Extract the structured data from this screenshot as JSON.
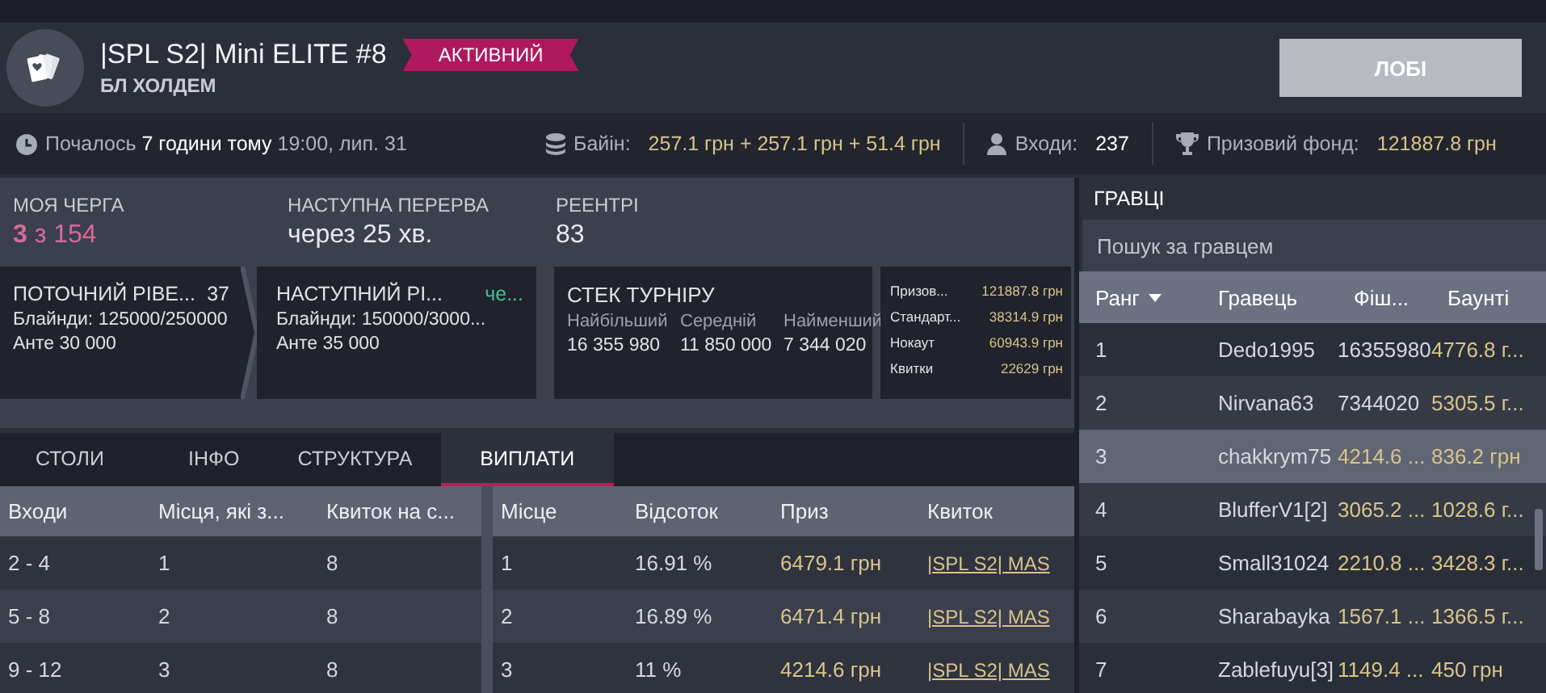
{
  "header": {
    "title": "|SPL S2| Mini ELITE #8",
    "status": "АКТИВНИЙ",
    "game": "БЛ ХОЛДЕМ",
    "lobby_button": "ЛОБІ"
  },
  "info_bar": {
    "started": "Почалось **7 години тому** 19:00, лип. 31",
    "buyin_label": "Байін:",
    "buyin": "257.1 грн + 257.1 грн + 51.4 грн",
    "entries_label": "Входи:",
    "entries": "237",
    "prize_label": "Призовий фонд:",
    "prize": "121887.8 грн"
  },
  "stats": [
    {
      "label": "МОЯ ЧЕРГА",
      "value": "**3** з 154",
      "kind": "highlight"
    },
    {
      "label": "НАСТУПНА ПЕРЕРВА",
      "value": "через 25 хв.",
      "kind": "plain"
    },
    {
      "label": "РЕЕНТРІ",
      "value": "83",
      "kind": "plain"
    }
  ],
  "levels": [
    {
      "title": "ПОТОЧНИЙ РІВЕ...",
      "extra": "37",
      "kind": "number",
      "blinds": "Блайнди: 125000/250000",
      "ante": "Анте 30 000"
    },
    {
      "title": "НАСТУПНИЙ РІ...",
      "extra": "че...",
      "kind": "time",
      "blinds": "Блайнди: 150000/3000...",
      "ante": "Анте 35 000"
    }
  ],
  "stack": {
    "title": "СТЕК ТУРНІРУ",
    "columns": [
      {
        "label": "Найбільший",
        "value": "16 355 980"
      },
      {
        "label": "Середній",
        "value": "11 850 000"
      },
      {
        "label": "Найменший",
        "value": "7 344 020"
      }
    ]
  },
  "prize_breakdown": [
    {
      "label": "Призов...",
      "value": "121887.8 грн"
    },
    {
      "label": "Стандарт...",
      "value": "38314.9 грн"
    },
    {
      "label": "Нокаут",
      "value": "60943.9 грн"
    },
    {
      "label": "Квитки",
      "value": "22629 грн"
    }
  ],
  "tabs": [
    {
      "label": "СТОЛИ",
      "selected": false
    },
    {
      "label": "ІНФО",
      "selected": false
    },
    {
      "label": "СТРУКТУРА",
      "selected": false
    },
    {
      "label": "ВИПЛАТИ",
      "selected": true
    }
  ],
  "payouts": {
    "left_columns": [
      "Входи",
      "Місця, які з...",
      "Квиток на с..."
    ],
    "right_columns": [
      "Місце",
      "Відсоток",
      "Приз",
      "Квиток"
    ],
    "rows": [
      {
        "entries": "2 - 4",
        "places": "1",
        "ticket_place": "8",
        "place": "1",
        "percent": "16.91 %",
        "prize": "6479.1 грн",
        "ticket": "|SPL S2| MAS"
      },
      {
        "entries": "5 - 8",
        "places": "2",
        "ticket_place": "8",
        "place": "2",
        "percent": "16.89 %",
        "prize": "6471.4 грн",
        "ticket": "|SPL S2| MAS"
      },
      {
        "entries": "9 - 12",
        "places": "3",
        "ticket_place": "8",
        "place": "3",
        "percent": "11 %",
        "prize": "4214.6 грн",
        "ticket": "|SPL S2| MAS"
      }
    ]
  },
  "players": {
    "title": "ГРАВЦІ",
    "search": {
      "placeholder": "Пошук за гравцем"
    },
    "columns": [
      {
        "label": "Ранг",
        "sorted": true
      },
      {
        "label": "Гравець",
        "sorted": false
      },
      {
        "label": "Фіш...",
        "sorted": false
      },
      {
        "label": "Баунті",
        "sorted": false
      }
    ],
    "rows": [
      {
        "rank": "1",
        "name": "Dedo1995",
        "chips": "16355980",
        "kind": "plain",
        "bounty": "4776.8 г...",
        "selected": false
      },
      {
        "rank": "2",
        "name": "Nirvana63",
        "chips": "7344020",
        "kind": "plain",
        "bounty": "5305.5 г...",
        "selected": false
      },
      {
        "rank": "3",
        "name": "chakkrym75",
        "chips": "4214.6 ...",
        "kind": "money",
        "bounty": "836.2 грн",
        "selected": true
      },
      {
        "rank": "4",
        "name": "BlufferV1[2]",
        "chips": "3065.2 ...",
        "kind": "money",
        "bounty": "1028.6 г...",
        "selected": false
      },
      {
        "rank": "5",
        "name": "Small31024",
        "chips": "2210.8 ...",
        "kind": "money",
        "bounty": "3428.3 г...",
        "selected": false
      },
      {
        "rank": "6",
        "name": "Sharabayka",
        "chips": "1567.1 ...",
        "kind": "money",
        "bounty": "1366.5 г...",
        "selected": false
      },
      {
        "rank": "7",
        "name": "Zablefuyu[3]",
        "chips": "1149.4 ...",
        "kind": "money",
        "bounty": "450 грн",
        "selected": false
      }
    ]
  }
}
